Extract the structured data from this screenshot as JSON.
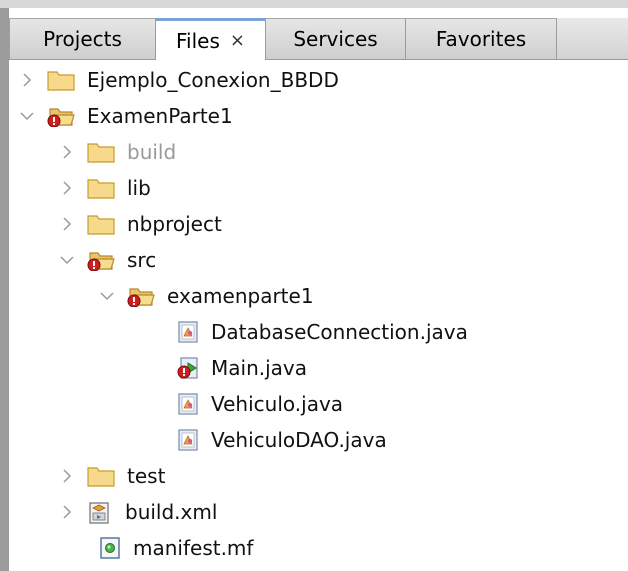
{
  "tabs": [
    {
      "label": "Projects",
      "active": false
    },
    {
      "label": "Files",
      "active": true,
      "close": "×"
    },
    {
      "label": "Services",
      "active": false
    },
    {
      "label": "Favorites",
      "active": false
    }
  ],
  "tree": [
    {
      "label": "Ejemplo_Conexion_BBDD",
      "icon": "folder-icon",
      "expanded": false
    },
    {
      "label": "ExamenParte1",
      "icon": "open-folder-error-icon",
      "expanded": true
    },
    {
      "label": "build",
      "icon": "folder-icon",
      "expanded": false,
      "muted": true
    },
    {
      "label": "lib",
      "icon": "folder-icon",
      "expanded": false
    },
    {
      "label": "nbproject",
      "icon": "folder-icon",
      "expanded": false
    },
    {
      "label": "src",
      "icon": "open-folder-error-icon",
      "expanded": true
    },
    {
      "label": "examenparte1",
      "icon": "open-folder-error-icon",
      "expanded": true
    },
    {
      "label": "DatabaseConnection.java",
      "icon": "java-file-icon"
    },
    {
      "label": "Main.java",
      "icon": "java-main-error-icon"
    },
    {
      "label": "Vehiculo.java",
      "icon": "java-file-icon"
    },
    {
      "label": "VehiculoDAO.java",
      "icon": "java-file-icon"
    },
    {
      "label": "test",
      "icon": "folder-icon",
      "expanded": false
    },
    {
      "label": "build.xml",
      "icon": "xml-file-icon",
      "expanded": false
    },
    {
      "label": "manifest.mf",
      "icon": "manifest-file-icon"
    }
  ]
}
